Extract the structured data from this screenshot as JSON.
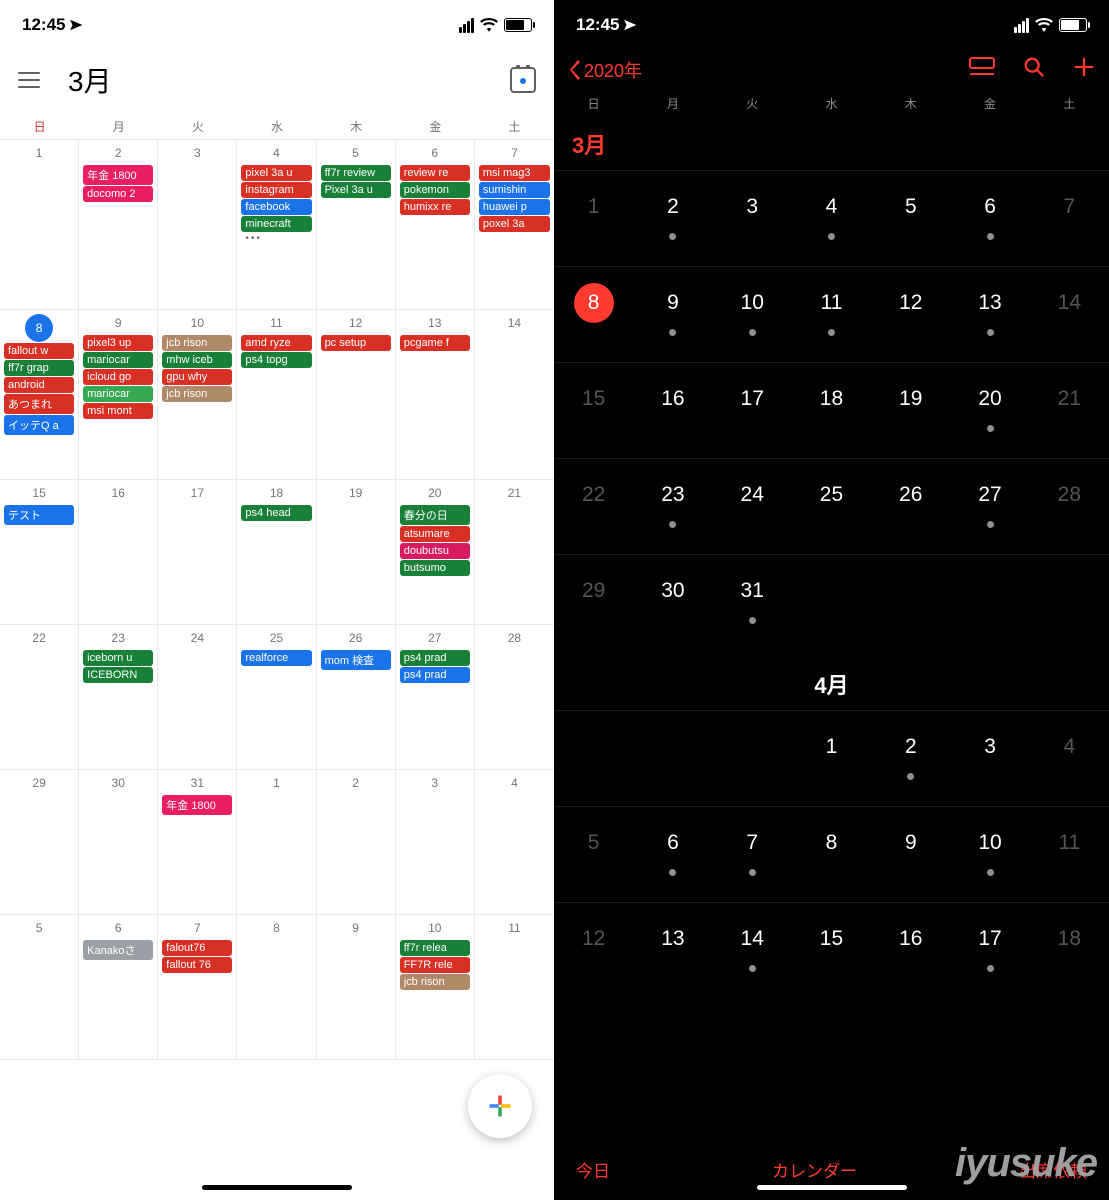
{
  "status_time": "12:45",
  "google": {
    "month_title": "3月",
    "dow": [
      "日",
      "月",
      "火",
      "水",
      "木",
      "金",
      "土"
    ],
    "weeks": [
      [
        {
          "n": "1",
          "ev": []
        },
        {
          "n": "2",
          "ev": [
            [
              "pink",
              "年金 1800"
            ],
            [
              "pink",
              "docomo 2"
            ]
          ]
        },
        {
          "n": "3",
          "ev": []
        },
        {
          "n": "4",
          "ev": [
            [
              "red",
              "pixel 3a u"
            ],
            [
              "red",
              "instagram"
            ],
            [
              "blue",
              "facebook"
            ],
            [
              "green",
              "minecraft"
            ]
          ],
          "more": true
        },
        {
          "n": "5",
          "ev": [
            [
              "green",
              "ff7r review"
            ],
            [
              "green",
              "Pixel 3a u"
            ]
          ]
        },
        {
          "n": "6",
          "ev": [
            [
              "red",
              "review re"
            ],
            [
              "green",
              "pokemon"
            ],
            [
              "red",
              "humixx re"
            ]
          ]
        },
        {
          "n": "7",
          "ev": [
            [
              "red",
              "msi mag3"
            ],
            [
              "blue",
              "sumishin"
            ],
            [
              "blue",
              "huawei p"
            ],
            [
              "red",
              "poxel 3a"
            ]
          ]
        }
      ],
      [
        {
          "n": "8",
          "today": true,
          "ev": [
            [
              "red",
              "fallout w"
            ],
            [
              "green",
              "ff7r grap"
            ],
            [
              "red",
              "android"
            ],
            [
              "red",
              "あつまれ"
            ],
            [
              "blue",
              "イッテQ a"
            ]
          ]
        },
        {
          "n": "9",
          "ev": [
            [
              "red",
              "pixel3 up"
            ],
            [
              "green",
              "mariocar"
            ],
            [
              "red",
              "icloud go"
            ],
            [
              "lgreen",
              "mariocar"
            ],
            [
              "red",
              "msi mont"
            ]
          ]
        },
        {
          "n": "10",
          "ev": [
            [
              "tan",
              "jcb rison"
            ],
            [
              "green",
              "mhw iceb"
            ],
            [
              "red",
              "gpu why"
            ],
            [
              "tan",
              "jcb rison"
            ]
          ]
        },
        {
          "n": "11",
          "ev": [
            [
              "red",
              "amd ryze"
            ],
            [
              "green",
              "ps4 topg"
            ]
          ]
        },
        {
          "n": "12",
          "ev": [
            [
              "red",
              "pc setup"
            ]
          ]
        },
        {
          "n": "13",
          "ev": [
            [
              "red",
              "pcgame f"
            ]
          ]
        },
        {
          "n": "14",
          "ev": []
        }
      ],
      [
        {
          "n": "15",
          "ev": [
            [
              "blue",
              "テスト"
            ]
          ]
        },
        {
          "n": "16",
          "ev": []
        },
        {
          "n": "17",
          "ev": []
        },
        {
          "n": "18",
          "ev": [
            [
              "green",
              "ps4 head"
            ]
          ]
        },
        {
          "n": "19",
          "ev": []
        },
        {
          "n": "20",
          "ev": [
            [
              "green",
              "春分の日"
            ],
            [
              "red",
              "atsumare"
            ],
            [
              "mag",
              "doubutsu"
            ],
            [
              "green",
              "butsumo"
            ]
          ]
        },
        {
          "n": "21",
          "ev": []
        }
      ],
      [
        {
          "n": "22",
          "ev": []
        },
        {
          "n": "23",
          "ev": [
            [
              "green",
              "iceborn u"
            ],
            [
              "green",
              "ICEBORN"
            ]
          ]
        },
        {
          "n": "24",
          "ev": []
        },
        {
          "n": "25",
          "ev": [
            [
              "blue",
              "realforce"
            ]
          ]
        },
        {
          "n": "26",
          "ev": [
            [
              "blue",
              "mom 検査"
            ]
          ]
        },
        {
          "n": "27",
          "ev": [
            [
              "green",
              "ps4 prad"
            ],
            [
              "blue",
              "ps4 prad"
            ]
          ]
        },
        {
          "n": "28",
          "ev": []
        }
      ],
      [
        {
          "n": "29",
          "ev": []
        },
        {
          "n": "30",
          "ev": []
        },
        {
          "n": "31",
          "ev": [
            [
              "pink",
              "年金 1800"
            ]
          ]
        },
        {
          "n": "1",
          "ev": []
        },
        {
          "n": "2",
          "ev": []
        },
        {
          "n": "3",
          "ev": []
        },
        {
          "n": "4",
          "ev": []
        }
      ],
      [
        {
          "n": "5",
          "ev": []
        },
        {
          "n": "6",
          "ev": [
            [
              "grey",
              "Kanakoさ"
            ]
          ]
        },
        {
          "n": "7",
          "ev": [
            [
              "red",
              "falout76"
            ],
            [
              "red",
              "fallout 76"
            ]
          ]
        },
        {
          "n": "8",
          "ev": []
        },
        {
          "n": "9",
          "ev": []
        },
        {
          "n": "10",
          "ev": [
            [
              "green",
              "ff7r relea"
            ],
            [
              "red",
              "FF7R rele"
            ],
            [
              "tan",
              "jcb rison"
            ]
          ]
        },
        {
          "n": "11",
          "ev": []
        }
      ]
    ]
  },
  "apple": {
    "back_label": "2020年",
    "dow": [
      "日",
      "月",
      "火",
      "水",
      "木",
      "金",
      "土"
    ],
    "month_march": "3月",
    "month_april": "4月",
    "march": [
      [
        {
          "n": "1",
          "dim": true
        },
        {
          "n": "2",
          "dot": true
        },
        {
          "n": "3"
        },
        {
          "n": "4",
          "dot": true
        },
        {
          "n": "5"
        },
        {
          "n": "6",
          "dot": true
        },
        {
          "n": "7",
          "dim": true
        }
      ],
      [
        {
          "n": "8",
          "today": true
        },
        {
          "n": "9",
          "dot": true
        },
        {
          "n": "10",
          "dot": true
        },
        {
          "n": "11",
          "dot": true
        },
        {
          "n": "12"
        },
        {
          "n": "13",
          "dot": true
        },
        {
          "n": "14",
          "dim": true
        }
      ],
      [
        {
          "n": "15",
          "dim": true
        },
        {
          "n": "16"
        },
        {
          "n": "17"
        },
        {
          "n": "18"
        },
        {
          "n": "19"
        },
        {
          "n": "20",
          "dot": true
        },
        {
          "n": "21",
          "dim": true
        }
      ],
      [
        {
          "n": "22",
          "dim": true
        },
        {
          "n": "23",
          "dot": true
        },
        {
          "n": "24"
        },
        {
          "n": "25"
        },
        {
          "n": "26"
        },
        {
          "n": "27",
          "dot": true
        },
        {
          "n": "28",
          "dim": true
        }
      ],
      [
        {
          "n": "29",
          "dim": true
        },
        {
          "n": "30"
        },
        {
          "n": "31",
          "dot": true
        },
        {
          "blank": true
        },
        {
          "blank": true
        },
        {
          "blank": true
        },
        {
          "blank": true
        }
      ]
    ],
    "april": [
      [
        {
          "blank": true
        },
        {
          "blank": true
        },
        {
          "blank": true
        },
        {
          "n": "1"
        },
        {
          "n": "2",
          "dot": true
        },
        {
          "n": "3"
        },
        {
          "n": "4",
          "dim": true
        }
      ],
      [
        {
          "n": "5",
          "dim": true
        },
        {
          "n": "6",
          "dot": true
        },
        {
          "n": "7",
          "dot": true
        },
        {
          "n": "8"
        },
        {
          "n": "9"
        },
        {
          "n": "10",
          "dot": true
        },
        {
          "n": "11",
          "dim": true
        }
      ],
      [
        {
          "n": "12",
          "dim": true
        },
        {
          "n": "13"
        },
        {
          "n": "14",
          "dot": true
        },
        {
          "n": "15"
        },
        {
          "n": "16"
        },
        {
          "n": "17",
          "dot": true
        },
        {
          "n": "18",
          "dim": true
        }
      ]
    ],
    "footer": {
      "today": "今日",
      "calendars": "カレンダー",
      "inbox": "出席依頼"
    }
  },
  "watermark": "iyusuke"
}
